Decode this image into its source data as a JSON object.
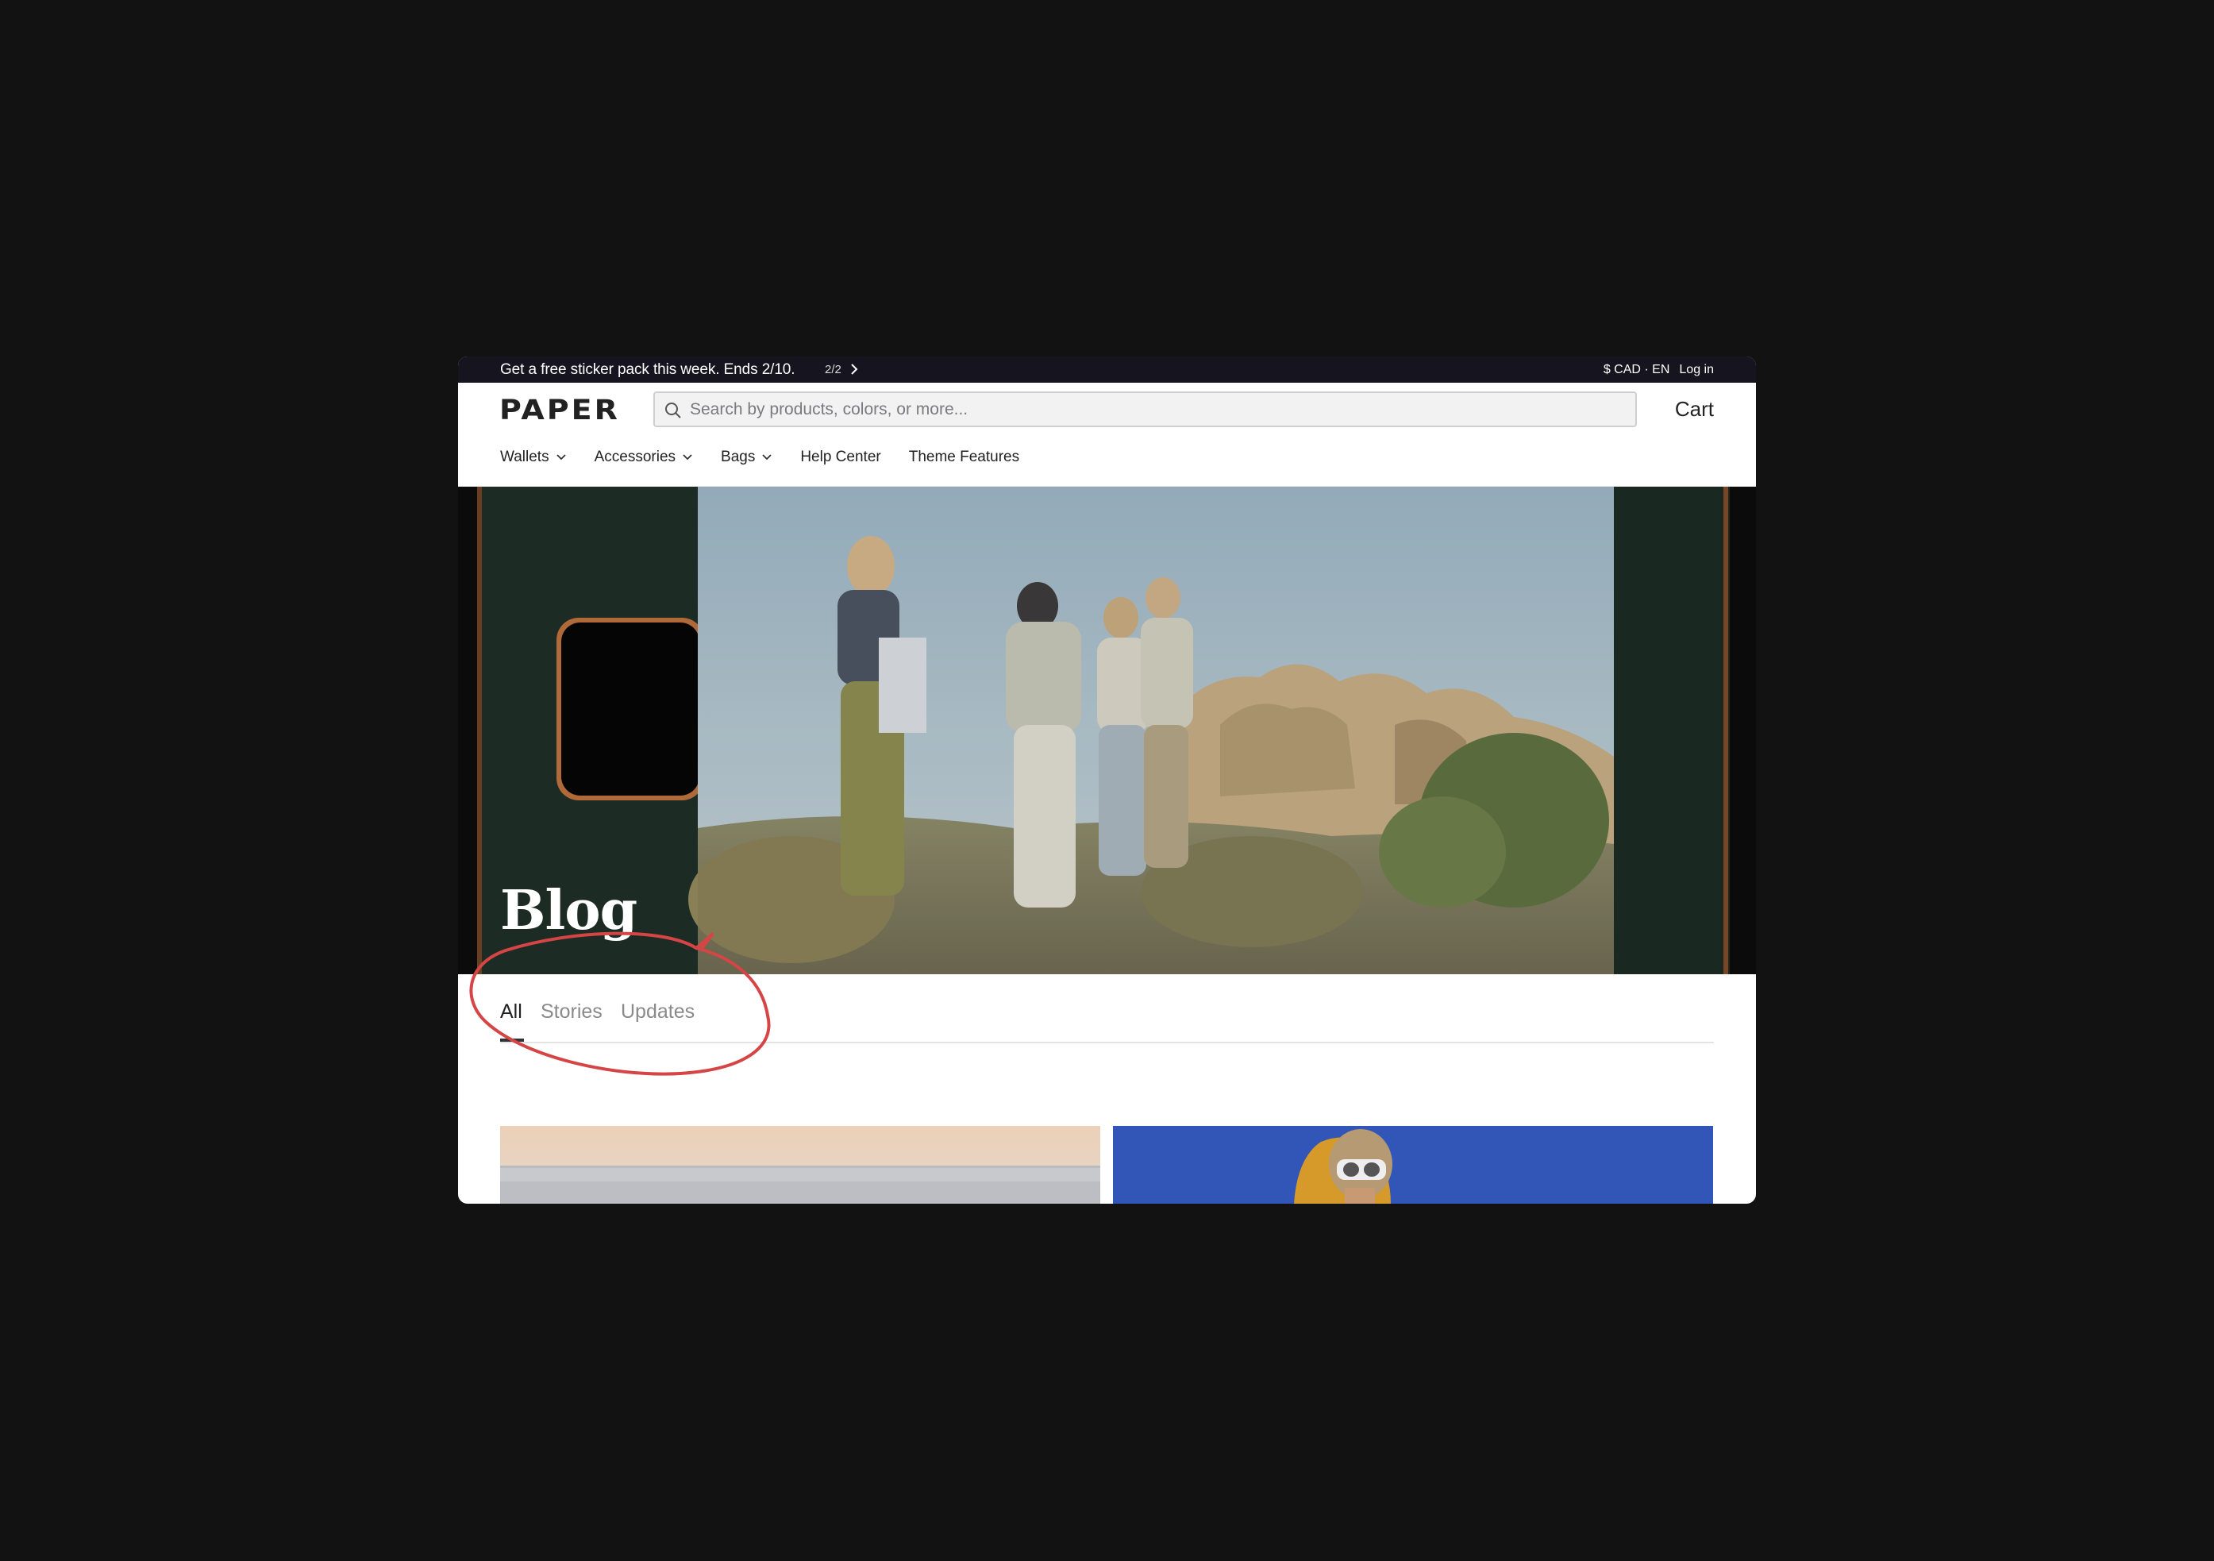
{
  "announcement": {
    "message": "Get a free sticker pack this week. Ends 2/10.",
    "pager": "2/2",
    "currency": "$ CAD · EN",
    "login": "Log in"
  },
  "header": {
    "logo": "PAPER",
    "search_placeholder": "Search by products, colors, or more...",
    "cart_label": "Cart"
  },
  "nav": {
    "items": [
      {
        "label": "Wallets",
        "has_dropdown": true
      },
      {
        "label": "Accessories",
        "has_dropdown": true
      },
      {
        "label": "Bags",
        "has_dropdown": true
      },
      {
        "label": "Help Center",
        "has_dropdown": false
      },
      {
        "label": "Theme Features",
        "has_dropdown": false
      }
    ]
  },
  "hero": {
    "title": "Blog"
  },
  "tabs": {
    "items": [
      {
        "label": "All",
        "active": true
      },
      {
        "label": "Stories",
        "active": false
      },
      {
        "label": "Updates",
        "active": false
      }
    ]
  },
  "colors": {
    "announcement_bg": "#15141f",
    "annotation_red": "#d64545",
    "card_right_sky": "#2d4fb0"
  }
}
